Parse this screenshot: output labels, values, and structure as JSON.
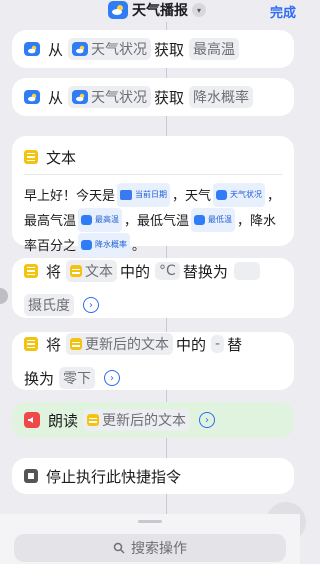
{
  "header": {
    "title": "天气播报",
    "done_label": "完成"
  },
  "actions": [
    {
      "verb": "从",
      "source": "天气状况",
      "get": "获取",
      "detail": "最高温"
    },
    {
      "verb": "从",
      "source": "天气状况",
      "get": "获取",
      "detail": "降水概率"
    }
  ],
  "text_action": {
    "label": "文本",
    "para1": "早上好！今天是",
    "token_date": "当前日期",
    "para2": "，天气",
    "token_weather": "天气状况",
    "para3": "，最高气温",
    "token_high": "最高温",
    "para4": "，最低气温",
    "token_low": "最低温",
    "para5": "，降水率百分之",
    "token_rain": "降水概率",
    "para6": "。"
  },
  "replace1": {
    "verb": "将",
    "token": "文本",
    "mid": "中的",
    "find": "°C",
    "replace_label": "替换为",
    "with": "摄氏度"
  },
  "replace2": {
    "verb": "将",
    "token": "更新后的文本",
    "mid": "中的",
    "find": "-",
    "replace_label": "替",
    "replace_label2": "换为",
    "with": "零下"
  },
  "speak": {
    "verb": "朗读",
    "token": "更新后的文本"
  },
  "stop": {
    "label": "停止执行此快捷指令"
  },
  "search": {
    "label": "搜索操作"
  },
  "colors": {
    "accent": "#2f6bf4",
    "weather_icon": "#2f7cf6",
    "text_icon": "#f2c40f",
    "speak_bg": "#dff3df",
    "speaker_icon": "#f04848"
  }
}
